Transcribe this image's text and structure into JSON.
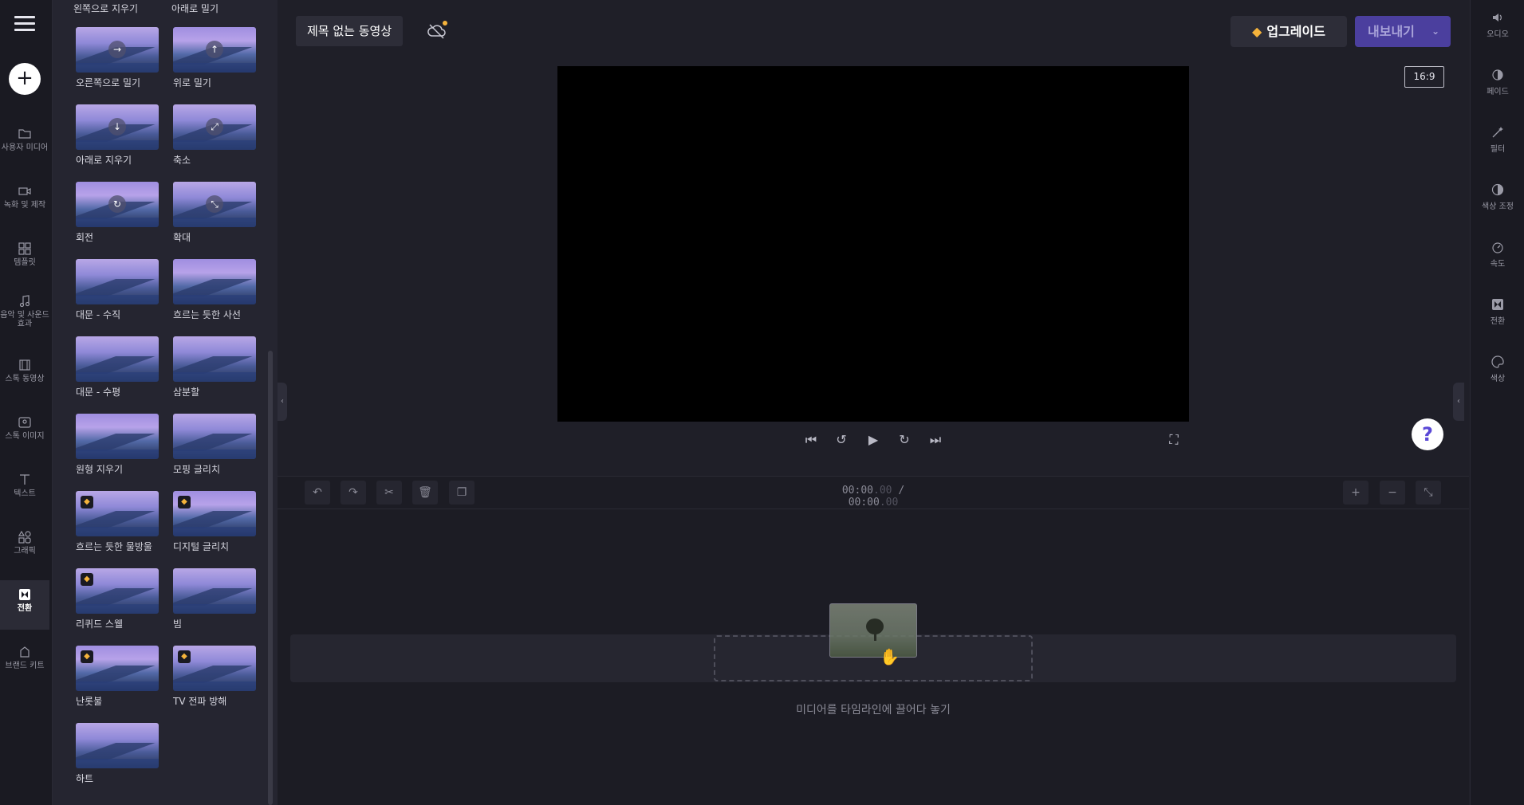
{
  "left_nav": {
    "items": [
      {
        "label": "사용자 미디어",
        "icon": "folder-icon"
      },
      {
        "label": "녹화 및 제작",
        "icon": "camera-icon"
      },
      {
        "label": "템플릿",
        "icon": "templates-icon"
      },
      {
        "label": "음악 및 사운드 효과",
        "icon": "music-icon"
      },
      {
        "label": "스톡 동영상",
        "icon": "film-icon"
      },
      {
        "label": "스톡 이미지",
        "icon": "image-icon"
      },
      {
        "label": "텍스트",
        "icon": "text-icon"
      },
      {
        "label": "그래픽",
        "icon": "shapes-icon"
      },
      {
        "label": "전환",
        "icon": "transition-icon",
        "active": true
      },
      {
        "label": "브랜드 키트",
        "icon": "brand-icon"
      }
    ]
  },
  "panel": {
    "top_labels": [
      "왼쪽으로 지우기",
      "아래로 밀기"
    ],
    "tiles": [
      {
        "name": "오른쪽으로 밀기",
        "glyph": "→",
        "premium": false
      },
      {
        "name": "위로 밀기",
        "glyph": "↑",
        "premium": false
      },
      {
        "name": "아래로 지우기",
        "glyph": "↓",
        "premium": false
      },
      {
        "name": "축소",
        "glyph": "⤢",
        "premium": false
      },
      {
        "name": "회전",
        "glyph": "↻",
        "premium": false
      },
      {
        "name": "확대",
        "glyph": "⤡",
        "premium": false
      },
      {
        "name": "대문 - 수직",
        "glyph": "",
        "premium": false
      },
      {
        "name": "흐르는 듯한 사선",
        "glyph": "",
        "premium": false
      },
      {
        "name": "대문 - 수평",
        "glyph": "",
        "premium": false
      },
      {
        "name": "삼분할",
        "glyph": "",
        "premium": false
      },
      {
        "name": "원형 지우기",
        "glyph": "",
        "premium": false
      },
      {
        "name": "모핑 글리치",
        "glyph": "",
        "premium": false
      },
      {
        "name": "흐르는 듯한 물방울",
        "glyph": "",
        "premium": true
      },
      {
        "name": "디지털 글리치",
        "glyph": "",
        "premium": true
      },
      {
        "name": "리퀴드 스웰",
        "glyph": "",
        "premium": true
      },
      {
        "name": "빔",
        "glyph": "",
        "premium": false
      },
      {
        "name": "난롯불",
        "glyph": "",
        "premium": true
      },
      {
        "name": "TV 전파 방해",
        "glyph": "",
        "premium": true
      },
      {
        "name": "하트",
        "glyph": "",
        "premium": false
      }
    ]
  },
  "header": {
    "title": "제목 없는 동영상",
    "upgrade_label": "업그레이드",
    "export_label": "내보내기"
  },
  "preview": {
    "aspect_ratio": "16:9"
  },
  "timeline": {
    "time_current": "00:00",
    "time_current_frac": ".00",
    "time_sep": "/",
    "time_total": "00:00",
    "time_total_frac": ".00",
    "drop_hint": "미디어를 타임라인에 끌어다 놓기"
  },
  "right_nav": {
    "items": [
      {
        "label": "오디오",
        "icon": "speaker-icon"
      },
      {
        "label": "페이드",
        "icon": "fade-icon"
      },
      {
        "label": "필터",
        "icon": "magic-wand-icon"
      },
      {
        "label": "색상 조정",
        "icon": "contrast-icon"
      },
      {
        "label": "속도",
        "icon": "speedometer-icon"
      },
      {
        "label": "전환",
        "icon": "transition-icon"
      },
      {
        "label": "색상",
        "icon": "palette-icon"
      }
    ]
  },
  "colors": {
    "accent": "#4b3f9e",
    "premium_gem": "#f5b33b",
    "help_icon": "#5a48d6"
  }
}
